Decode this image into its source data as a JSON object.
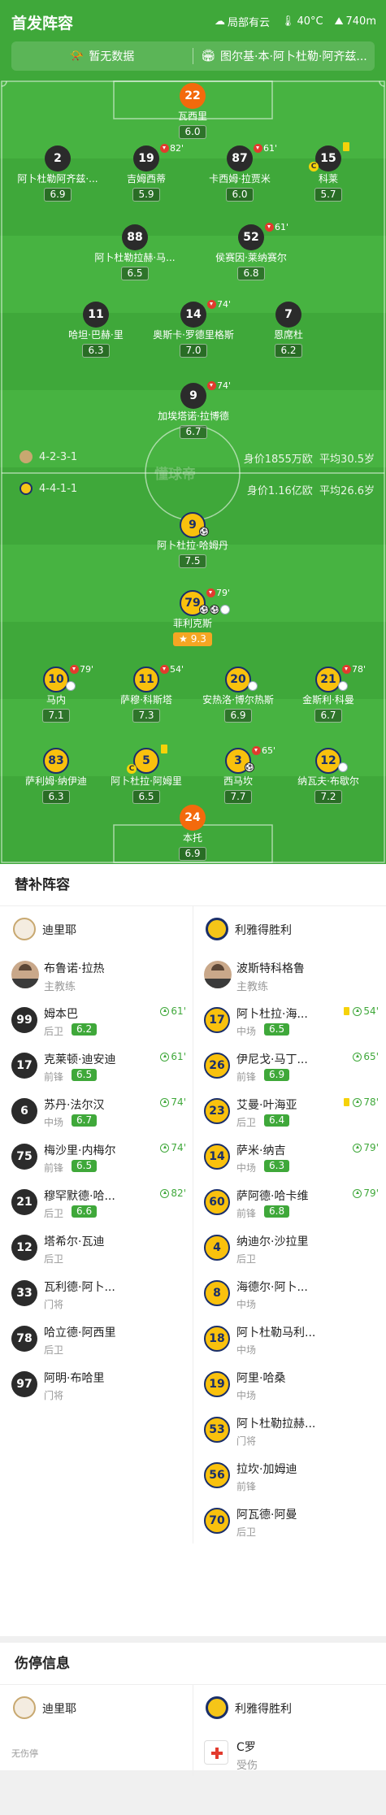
{
  "header": {
    "title": "首发阵容",
    "weather": "局部有云",
    "temperature": "40°C",
    "altitude": "740m",
    "left_info": "暂无数据",
    "right_info": "图尔基·本·阿卜杜勒·阿齐兹..."
  },
  "home_lineup": [
    {
      "num": "22",
      "name": "瓦西里",
      "rating": "6.0",
      "color": "orange"
    },
    {
      "num": "2",
      "name": "阿卜杜勒阿齐兹·...",
      "rating": "6.9"
    },
    {
      "num": "19",
      "name": "吉姆西蒂",
      "rating": "5.9",
      "sub_minute": "82'"
    },
    {
      "num": "87",
      "name": "卡西姆·拉贾米",
      "rating": "6.0",
      "sub_minute": "61'"
    },
    {
      "num": "15",
      "name": "科莱",
      "rating": "5.7",
      "captain": "C"
    },
    {
      "num": "88",
      "name": "阿卜杜勒拉赫·马...",
      "rating": "6.5"
    },
    {
      "num": "52",
      "name": "侯赛因·莱纳赛尔",
      "rating": "6.8",
      "sub_minute": "61'"
    },
    {
      "num": "11",
      "name": "哈坦·巴赫·里",
      "rating": "6.3"
    },
    {
      "num": "14",
      "name": "奥斯卡·罗德里格斯",
      "rating": "7.0",
      "sub_minute": "74'"
    },
    {
      "num": "7",
      "name": "恩席杜",
      "rating": "6.2"
    },
    {
      "num": "9",
      "name": "加埃塔诺·拉博德",
      "rating": "6.7",
      "sub_minute": "74'"
    }
  ],
  "formations": {
    "home": {
      "shape": "4-2-3-1",
      "value": "身价1855万欧",
      "avg_age": "平均30.5岁"
    },
    "away": {
      "shape": "4-4-1-1",
      "value": "身价1.16亿欧",
      "avg_age": "平均26.6岁"
    }
  },
  "watermark": "懂球帝",
  "away_lineup": [
    {
      "num": "9",
      "name": "阿卜杜拉·哈姆丹",
      "rating": "7.5"
    },
    {
      "num": "79",
      "name": "菲利克斯",
      "rating": "9.3",
      "sub_minute": "79'",
      "best": "★"
    },
    {
      "num": "10",
      "name": "马内",
      "rating": "7.1",
      "sub_minute": "79'"
    },
    {
      "num": "11",
      "name": "萨穆·科斯塔",
      "rating": "7.3",
      "sub_minute": "54'"
    },
    {
      "num": "20",
      "name": "安热洛·博尔热斯",
      "rating": "6.9"
    },
    {
      "num": "21",
      "name": "金斯利·科曼",
      "rating": "6.7",
      "sub_minute": "78'"
    },
    {
      "num": "83",
      "name": "萨利姆·纳伊迪",
      "rating": "6.3"
    },
    {
      "num": "5",
      "name": "阿卜杜拉·阿姆里",
      "rating": "6.5",
      "captain": "C"
    },
    {
      "num": "3",
      "name": "西马坎",
      "rating": "7.7",
      "sub_minute": "65'"
    },
    {
      "num": "12",
      "name": "纳瓦夫·布歇尔",
      "rating": "7.2"
    },
    {
      "num": "24",
      "name": "本托",
      "rating": "6.9",
      "color": "orange"
    }
  ],
  "subs": {
    "title": "替补阵容",
    "home_team": "迪里耶",
    "away_team": "利雅得胜利",
    "home_coach": {
      "name": "布鲁诺·拉热",
      "role": "主教练"
    },
    "away_coach": {
      "name": "波斯特科格鲁",
      "role": "主教练"
    },
    "home": [
      {
        "num": "99",
        "name": "姆本巴",
        "pos": "后卫",
        "rating": "6.2",
        "time": "61'"
      },
      {
        "num": "17",
        "name": "克莱顿·迪安迪",
        "pos": "前锋",
        "rating": "6.5",
        "time": "61'"
      },
      {
        "num": "6",
        "name": "苏丹·法尔汉",
        "pos": "中场",
        "rating": "6.7",
        "time": "74'"
      },
      {
        "num": "75",
        "name": "梅沙里·内梅尔",
        "pos": "前锋",
        "rating": "6.5",
        "time": "74'"
      },
      {
        "num": "21",
        "name": "穆罕默德·哈...",
        "pos": "后卫",
        "rating": "6.6",
        "time": "82'"
      },
      {
        "num": "12",
        "name": "塔希尔·瓦迪",
        "pos": "后卫"
      },
      {
        "num": "33",
        "name": "瓦利德·阿卜...",
        "pos": "门将"
      },
      {
        "num": "78",
        "name": "哈立德·阿西里",
        "pos": "后卫"
      },
      {
        "num": "97",
        "name": "阿明·布哈里",
        "pos": "门将"
      }
    ],
    "away": [
      {
        "num": "17",
        "name": "阿卜杜拉·海...",
        "pos": "中场",
        "rating": "6.5",
        "time": "54'",
        "yellow": "yes"
      },
      {
        "num": "26",
        "name": "伊尼戈·马丁...",
        "pos": "前锋",
        "rating": "6.9",
        "time": "65'"
      },
      {
        "num": "23",
        "name": "艾曼·叶海亚",
        "pos": "后卫",
        "rating": "6.4",
        "time": "78'",
        "yellow": "yes"
      },
      {
        "num": "14",
        "name": "萨米·纳吉",
        "pos": "中场",
        "rating": "6.3",
        "time": "79'"
      },
      {
        "num": "60",
        "name": "萨阿德·哈卡维",
        "pos": "前锋",
        "rating": "6.8",
        "time": "79'"
      },
      {
        "num": "4",
        "name": "纳迪尔·沙拉里",
        "pos": "后卫"
      },
      {
        "num": "8",
        "name": "海德尔·阿卜...",
        "pos": "中场"
      },
      {
        "num": "18",
        "name": "阿卜杜勒马利...",
        "pos": "中场"
      },
      {
        "num": "19",
        "name": "阿里·哈桑",
        "pos": "中场"
      },
      {
        "num": "53",
        "name": "阿卜杜勒拉赫...",
        "pos": "门将"
      },
      {
        "num": "56",
        "name": "拉坎·加姆迪",
        "pos": "前锋"
      },
      {
        "num": "70",
        "name": "阿瓦德·阿曼",
        "pos": "后卫"
      }
    ]
  },
  "injuries": {
    "title": "伤停信息",
    "home_team": "迪里耶",
    "away_team": "利雅得胜利",
    "home_none": "无伤停",
    "away": [
      {
        "name": "C罗",
        "status": "受伤"
      }
    ]
  }
}
